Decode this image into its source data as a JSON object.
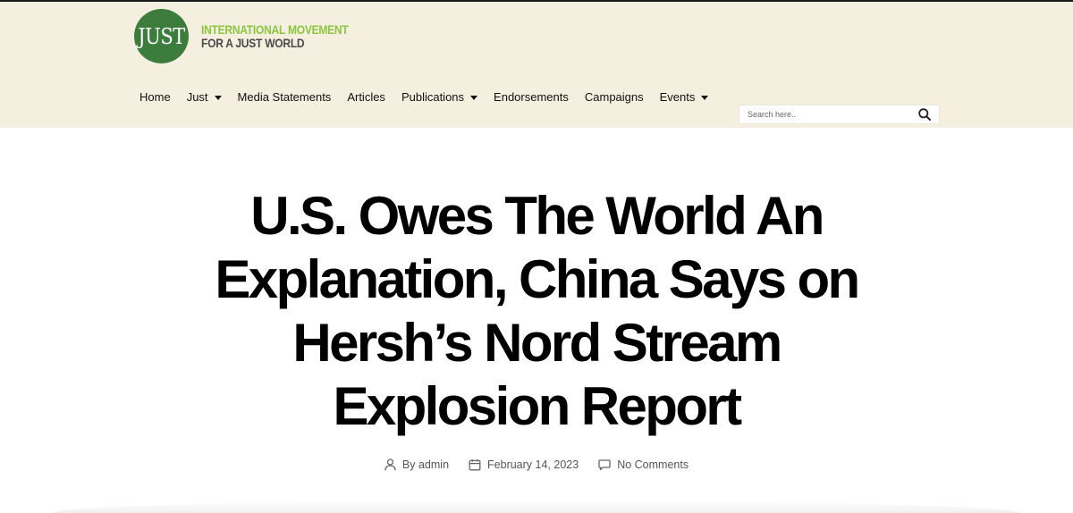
{
  "site": {
    "logo_badge": "JUST",
    "logo_line1": "INTERNATIONAL MOVEMENT",
    "logo_line2": "FOR A JUST WORLD"
  },
  "nav": {
    "items": [
      {
        "label": "Home",
        "has_dropdown": false
      },
      {
        "label": "Just",
        "has_dropdown": true
      },
      {
        "label": "Media Statements",
        "has_dropdown": false
      },
      {
        "label": "Articles",
        "has_dropdown": false
      },
      {
        "label": "Publications",
        "has_dropdown": true
      },
      {
        "label": "Endorsements",
        "has_dropdown": false
      },
      {
        "label": "Campaigns",
        "has_dropdown": false
      },
      {
        "label": "Events",
        "has_dropdown": true
      }
    ]
  },
  "search": {
    "placeholder": "Search here..",
    "icon": "search-icon"
  },
  "article": {
    "title": "U.S. Owes The World An Explanation, China Says on Hersh’s Nord Stream Explosion Report",
    "author_prefix": "By",
    "author": "admin",
    "date": "February 14, 2023",
    "comments": "No Comments"
  },
  "colors": {
    "header_bg": "#f5efe0",
    "logo_green": "#3c7d3e",
    "logo_accent": "#8cc63f",
    "text": "#000000",
    "meta_text": "#555555"
  }
}
